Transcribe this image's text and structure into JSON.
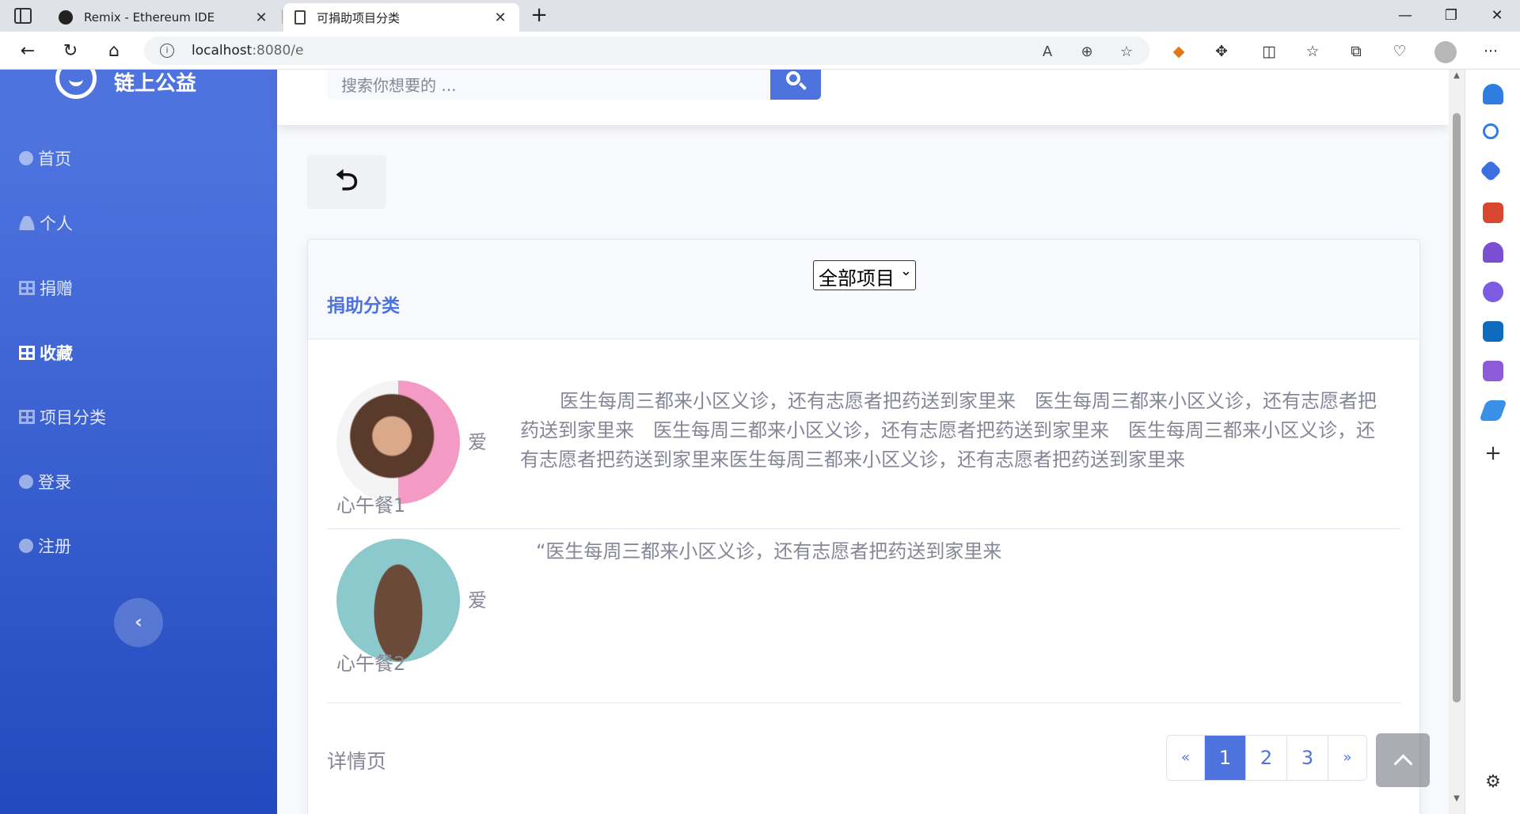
{
  "browser": {
    "tabs": [
      {
        "title": "Remix - Ethereum IDE",
        "close": "✕"
      },
      {
        "title": "可捐助项目分类",
        "close": "✕"
      }
    ],
    "new_tab": "+",
    "window_controls": {
      "minimize": "—",
      "restore": "❐",
      "close": "✕"
    },
    "nav": {
      "back": "←",
      "reload": "↻",
      "home": "⌂"
    },
    "url_host": "localhost",
    "url_rest": ":8080/e",
    "more": "···"
  },
  "sidebar": {
    "brand": "链上公益",
    "items": [
      {
        "label": "首页",
        "icon": "tachometer-icon"
      },
      {
        "label": "个人",
        "icon": "user-icon"
      },
      {
        "label": "捐赠",
        "icon": "table-icon"
      },
      {
        "label": "收藏",
        "icon": "table-icon",
        "active": true
      },
      {
        "label": "项目分类",
        "icon": "table-icon"
      },
      {
        "label": "登录",
        "icon": "user-circle-icon"
      },
      {
        "label": "注册",
        "icon": "user-circle-icon"
      }
    ],
    "toggle": "‹"
  },
  "topbar": {
    "search_placeholder": "搜索你想要的 ..."
  },
  "main": {
    "back_symbol": "⮌",
    "category_select": "全部项目",
    "title": "捐助分类",
    "projects": [
      {
        "name_a": "爱",
        "name_b": "心午餐1",
        "desc": "医生每周三都来小区义诊，还有志愿者把药送到家里来　医生每周三都来小区义诊，还有志愿者把药送到家里来　医生每周三都来小区义诊，还有志愿者把药送到家里来　医生每周三都来小区义诊，还有志愿者把药送到家里来医生每周三都来小区义诊，还有志愿者把药送到家里来"
      },
      {
        "name_a": "爱",
        "name_b": "心午餐2",
        "desc": "“医生每周三都来小区义诊，还有志愿者把药送到家里来"
      }
    ],
    "detail_link": "详情页",
    "pagination": {
      "prev": "«",
      "pages": [
        "1",
        "2",
        "3"
      ],
      "current": "1",
      "next": "»"
    }
  },
  "colors": {
    "primary": "#4e73df",
    "sidebar_dark": "#224abe",
    "text_muted": "#858796"
  }
}
